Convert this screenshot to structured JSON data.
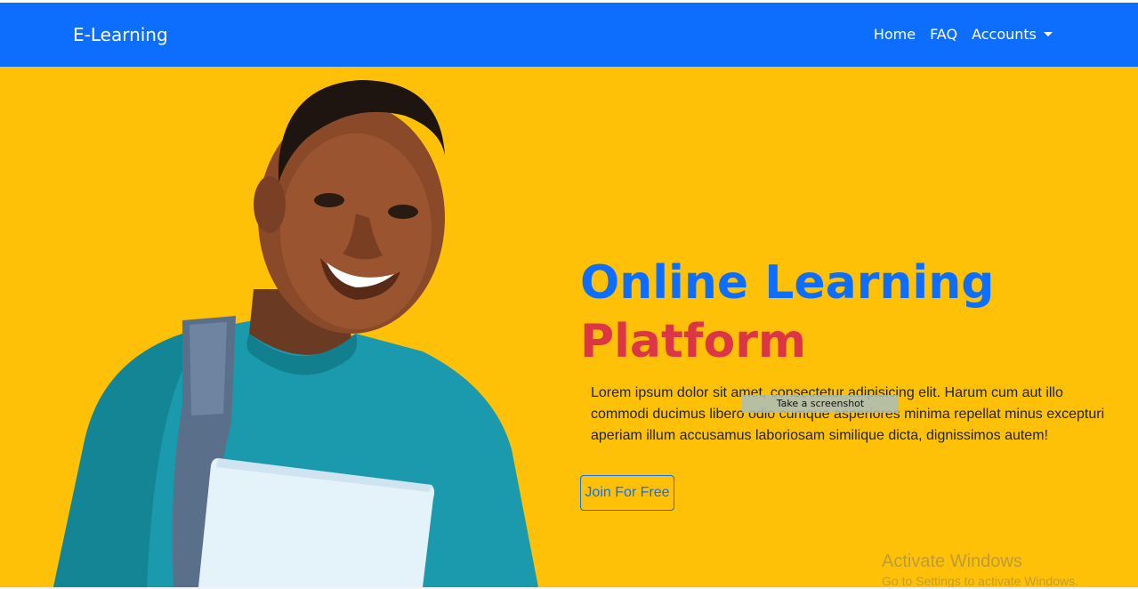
{
  "navbar": {
    "brand": "E-Learning",
    "links": [
      {
        "label": "Home"
      },
      {
        "label": "FAQ"
      },
      {
        "label": "Accounts"
      }
    ],
    "color": "#0d6efd"
  },
  "hero": {
    "background": "#ffc107",
    "title_line1": "Online Learning",
    "title_line2": "Platform",
    "description": "Lorem ipsum dolor sit amet, consectetur adipisicing elit. Harum cum aut illo commodi ducimus libero odio cumque asperiores minima repellat minus excepturi aperiam illum accusamus laboriosam similique dicta, dignissimos autem!",
    "cta_label": "Join For Free",
    "image_icon": "student-photo"
  },
  "overlay": {
    "tooltip": "Take a screenshot",
    "watermark_title": "Activate Windows",
    "watermark_sub": "Go to Settings to activate Windows."
  }
}
